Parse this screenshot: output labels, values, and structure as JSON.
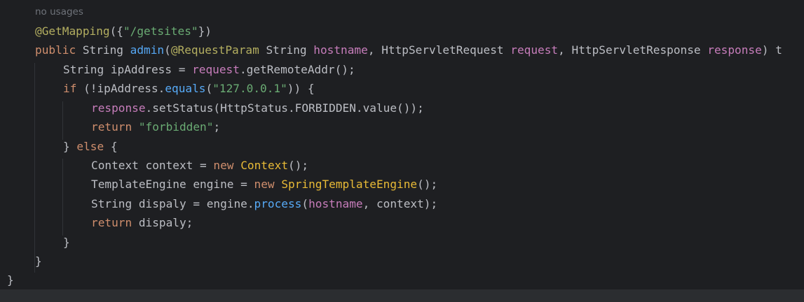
{
  "editor": {
    "usage_hint": "no usages",
    "lines": [
      {
        "tokens": [
          {
            "t": "@GetMapping",
            "k": "ann"
          },
          {
            "t": "({",
            "k": "plain"
          },
          {
            "t": "\"/getsites\"",
            "k": "str"
          },
          {
            "t": "})",
            "k": "plain"
          }
        ]
      },
      {
        "tokens": [
          {
            "t": "public",
            "k": "kw"
          },
          {
            "t": " String ",
            "k": "plain"
          },
          {
            "t": "admin",
            "k": "fn"
          },
          {
            "t": "(",
            "k": "plain"
          },
          {
            "t": "@RequestParam",
            "k": "ann"
          },
          {
            "t": " String ",
            "k": "plain"
          },
          {
            "t": "hostname",
            "k": "par"
          },
          {
            "t": ", HttpServletRequest ",
            "k": "plain"
          },
          {
            "t": "request",
            "k": "par"
          },
          {
            "t": ", HttpServletResponse ",
            "k": "plain"
          },
          {
            "t": "response",
            "k": "par"
          },
          {
            "t": ") t",
            "k": "plain"
          }
        ]
      },
      {
        "tokens": [
          {
            "t": "String ipAddress = ",
            "k": "plain"
          },
          {
            "t": "request",
            "k": "par"
          },
          {
            "t": ".getRemoteAddr();",
            "k": "plain"
          }
        ]
      },
      {
        "tokens": [
          {
            "t": "if",
            "k": "kw"
          },
          {
            "t": " (!ipAddress.",
            "k": "plain"
          },
          {
            "t": "equals",
            "k": "mth"
          },
          {
            "t": "(",
            "k": "plain"
          },
          {
            "t": "\"127.0.0.1\"",
            "k": "str"
          },
          {
            "t": ")) {",
            "k": "plain"
          }
        ]
      },
      {
        "tokens": [
          {
            "t": "response",
            "k": "par"
          },
          {
            "t": ".setStatus(HttpStatus.FORBIDDEN.value());",
            "k": "plain"
          }
        ]
      },
      {
        "tokens": [
          {
            "t": "return",
            "k": "kw"
          },
          {
            "t": " ",
            "k": "plain"
          },
          {
            "t": "\"forbidden\"",
            "k": "str"
          },
          {
            "t": ";",
            "k": "plain"
          }
        ]
      },
      {
        "tokens": [
          {
            "t": "} ",
            "k": "plain"
          },
          {
            "t": "else",
            "k": "kw"
          },
          {
            "t": " {",
            "k": "plain"
          }
        ]
      },
      {
        "tokens": [
          {
            "t": "Context context = ",
            "k": "plain"
          },
          {
            "t": "new",
            "k": "kw"
          },
          {
            "t": " ",
            "k": "plain"
          },
          {
            "t": "Context",
            "k": "cls"
          },
          {
            "t": "();",
            "k": "plain"
          }
        ]
      },
      {
        "tokens": [
          {
            "t": "TemplateEngine engine = ",
            "k": "plain"
          },
          {
            "t": "new",
            "k": "kw"
          },
          {
            "t": " ",
            "k": "plain"
          },
          {
            "t": "SpringTemplateEngine",
            "k": "cls"
          },
          {
            "t": "();",
            "k": "plain"
          }
        ]
      },
      {
        "tokens": [
          {
            "t": "String dispaly = engine.",
            "k": "plain"
          },
          {
            "t": "process",
            "k": "mth"
          },
          {
            "t": "(",
            "k": "plain"
          },
          {
            "t": "hostname",
            "k": "par"
          },
          {
            "t": ", context);",
            "k": "plain"
          }
        ]
      },
      {
        "tokens": [
          {
            "t": "return",
            "k": "kw"
          },
          {
            "t": " dispaly;",
            "k": "plain"
          }
        ]
      },
      {
        "tokens": [
          {
            "t": "}",
            "k": "plain"
          }
        ]
      },
      {
        "tokens": [
          {
            "t": "}",
            "k": "plain"
          }
        ]
      },
      {
        "tokens": [
          {
            "t": "}",
            "k": "plain"
          }
        ]
      }
    ]
  },
  "colors": {
    "background": "#1e1f22",
    "plain": "#bcbec4",
    "keyword": "#cf8e6d",
    "string": "#6aab73",
    "annotation": "#b3ae60",
    "method_decl": "#56a8f5",
    "parameter": "#c77dbb",
    "class_ref": "#e8ba36"
  }
}
